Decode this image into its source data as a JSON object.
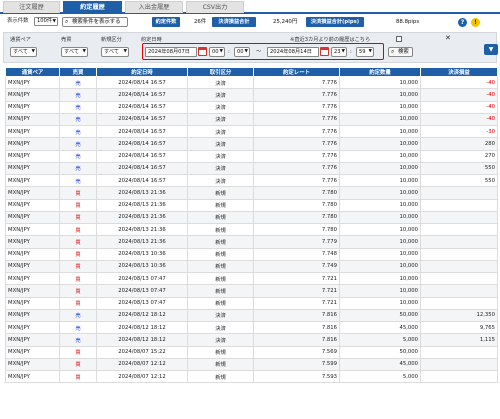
{
  "tabs": [
    "注文履歴",
    "約定履歴",
    "入出金履歴",
    "CSV出力"
  ],
  "active_tab": 1,
  "summary": {
    "display_count_label": "表示件数",
    "display_count_value": "100件",
    "show_search_button": "検索条件を表示する",
    "executed_count_label": "約定件数",
    "executed_count_value": "26件",
    "settlement_pl_label": "決済損益合計",
    "settlement_pl_value": "25,240円",
    "settlement_pips_label": "決済損益合計(pips)",
    "settlement_pips_value": "88.8pips"
  },
  "filter": {
    "pair_label": "通貨ペア",
    "pair_value": "すべて",
    "side_label": "売買",
    "side_value": "すべて",
    "newclose_label": "新規区分",
    "newclose_value": "すべて",
    "date_label": "約定日時",
    "date_from": "2024年08月07日",
    "hour_from": "00",
    "min_from": "00",
    "tilde": "〜",
    "date_to": "2024年08月14日",
    "hour_to": "23",
    "min_to": "59",
    "colon": ":",
    "search_button": "検索",
    "history_note": "※直近3カ月より前の履歴はこちら",
    "close": "✕"
  },
  "table": {
    "headers": [
      "通貨ペア",
      "売買",
      "約定日時",
      "取引区分",
      "約定レート",
      "約定数量",
      "決済損益"
    ],
    "rows": [
      [
        "MXN/JPY",
        "売",
        "2024/08/14 16:57",
        "決済",
        "7.776",
        "10,000",
        "-40"
      ],
      [
        "MXN/JPY",
        "売",
        "2024/08/14 16:57",
        "決済",
        "7.776",
        "10,000",
        "-40"
      ],
      [
        "MXN/JPY",
        "売",
        "2024/08/14 16:57",
        "決済",
        "7.776",
        "10,000",
        "-40"
      ],
      [
        "MXN/JPY",
        "売",
        "2024/08/14 16:57",
        "決済",
        "7.776",
        "10,000",
        "-40"
      ],
      [
        "MXN/JPY",
        "売",
        "2024/08/14 16:57",
        "決済",
        "7.776",
        "10,000",
        "-30"
      ],
      [
        "MXN/JPY",
        "売",
        "2024/08/14 16:57",
        "決済",
        "7.776",
        "10,000",
        "280"
      ],
      [
        "MXN/JPY",
        "売",
        "2024/08/14 16:57",
        "決済",
        "7.776",
        "10,000",
        "270"
      ],
      [
        "MXN/JPY",
        "売",
        "2024/08/14 16:57",
        "決済",
        "7.776",
        "10,000",
        "550"
      ],
      [
        "MXN/JPY",
        "売",
        "2024/08/14 16:57",
        "決済",
        "7.776",
        "10,000",
        "550"
      ],
      [
        "MXN/JPY",
        "買",
        "2024/08/13 21:36",
        "新規",
        "7.780",
        "10,000",
        ""
      ],
      [
        "MXN/JPY",
        "買",
        "2024/08/13 21:36",
        "新規",
        "7.780",
        "10,000",
        ""
      ],
      [
        "MXN/JPY",
        "買",
        "2024/08/13 21:36",
        "新規",
        "7.780",
        "10,000",
        ""
      ],
      [
        "MXN/JPY",
        "買",
        "2024/08/13 21:36",
        "新規",
        "7.780",
        "10,000",
        ""
      ],
      [
        "MXN/JPY",
        "買",
        "2024/08/13 21:36",
        "新規",
        "7.779",
        "10,000",
        ""
      ],
      [
        "MXN/JPY",
        "買",
        "2024/08/13 10:36",
        "新規",
        "7.748",
        "10,000",
        ""
      ],
      [
        "MXN/JPY",
        "買",
        "2024/08/13 10:36",
        "新規",
        "7.749",
        "10,000",
        ""
      ],
      [
        "MXN/JPY",
        "買",
        "2024/08/13 07:47",
        "新規",
        "7.721",
        "10,000",
        ""
      ],
      [
        "MXN/JPY",
        "買",
        "2024/08/13 07:47",
        "新規",
        "7.721",
        "10,000",
        ""
      ],
      [
        "MXN/JPY",
        "買",
        "2024/08/13 07:47",
        "新規",
        "7.721",
        "10,000",
        ""
      ],
      [
        "MXN/JPY",
        "売",
        "2024/08/12 18:12",
        "決済",
        "7.816",
        "50,000",
        "12,350"
      ],
      [
        "MXN/JPY",
        "売",
        "2024/08/12 18:12",
        "決済",
        "7.816",
        "45,000",
        "9,765"
      ],
      [
        "MXN/JPY",
        "売",
        "2024/08/12 18:12",
        "決済",
        "7.816",
        "5,000",
        "1,115"
      ],
      [
        "MXN/JPY",
        "買",
        "2024/08/07 15:22",
        "新規",
        "7.569",
        "50,000",
        ""
      ],
      [
        "MXN/JPY",
        "買",
        "2024/08/07 12:12",
        "新規",
        "7.599",
        "45,000",
        ""
      ],
      [
        "MXN/JPY",
        "買",
        "2024/08/07 12:12",
        "新規",
        "7.593",
        "5,000",
        ""
      ]
    ]
  },
  "colors": {
    "accent": "#1f5fa8",
    "buy": "#d40000",
    "sell": "#1e3fd8",
    "negative": "#d40000",
    "date_highlight": "#e00000"
  },
  "icons": [
    "search-icon",
    "calendar-icon",
    "help-icon",
    "warning-icon",
    "close-icon",
    "collapse-icon"
  ]
}
